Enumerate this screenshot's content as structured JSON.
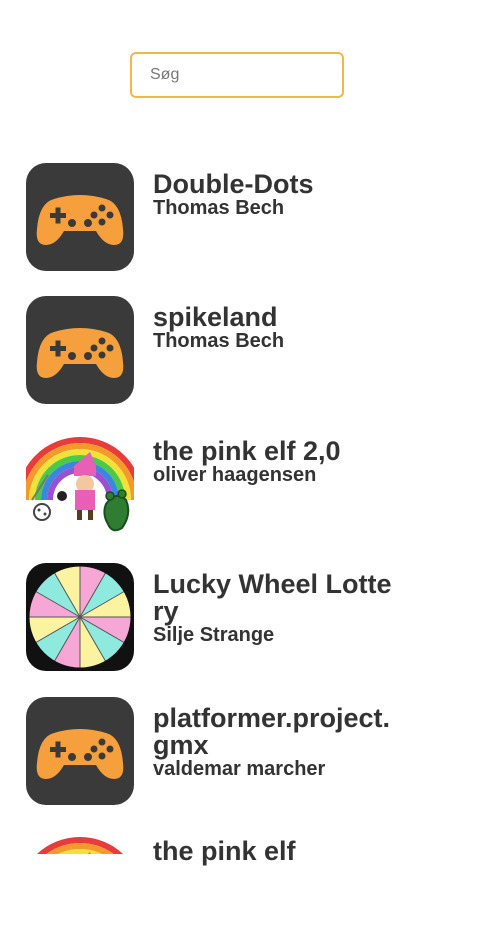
{
  "search": {
    "placeholder": "Søg",
    "value": ""
  },
  "games": [
    {
      "title": "Double-Dots",
      "author": "Thomas Bech",
      "icon": "gamepad-icon"
    },
    {
      "title": "spikeland",
      "author": "Thomas Bech",
      "icon": "gamepad-icon"
    },
    {
      "title": "the pink elf 2,0",
      "author": "oliver haagensen",
      "icon": "pink-elf-rainbow-icon"
    },
    {
      "title": "Lucky Wheel Lottery",
      "author": "Silje Strange",
      "icon": "lucky-wheel-icon"
    },
    {
      "title": "platformer.project.gmx",
      "author": "valdemar marcher",
      "icon": "gamepad-icon"
    },
    {
      "title": "the pink elf",
      "author": "",
      "icon": "pink-elf-rainbow-icon"
    }
  ],
  "colors": {
    "accent": "#f0b847",
    "gamepad_tile": "#3a3a3a",
    "gamepad": "#f5a03c",
    "text": "#333333"
  }
}
